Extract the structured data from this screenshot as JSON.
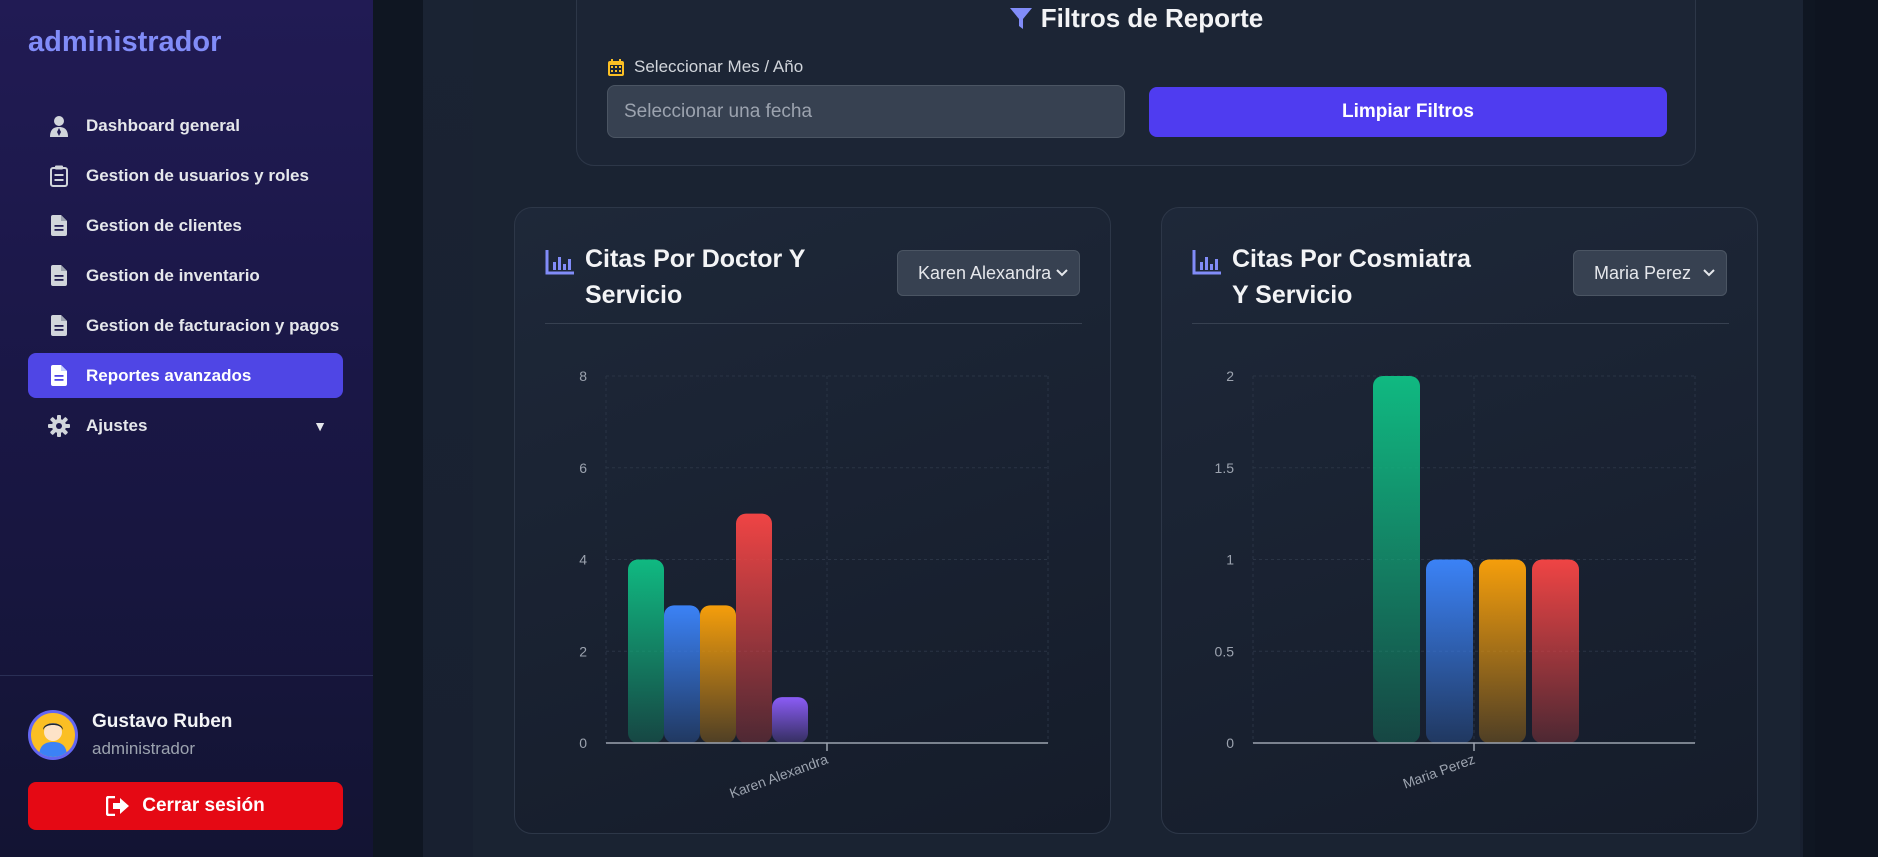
{
  "sidebar": {
    "brand": "administrador",
    "items": [
      {
        "label": "Dashboard general",
        "icon": "user-tie-icon"
      },
      {
        "label": "Gestion de usuarios y roles",
        "icon": "clipboard-list-icon"
      },
      {
        "label": "Gestion de clientes",
        "icon": "file-icon"
      },
      {
        "label": "Gestion de inventario",
        "icon": "file-icon"
      },
      {
        "label": "Gestion de facturacion y pagos",
        "icon": "file-icon"
      },
      {
        "label": "Reportes avanzados",
        "icon": "file-icon",
        "active": true
      },
      {
        "label": "Ajustes",
        "icon": "gear-icon",
        "caret": "▼"
      }
    ],
    "user": {
      "name": "Gustavo Ruben",
      "role": "administrador"
    },
    "logout_label": "Cerrar sesión"
  },
  "filters": {
    "title": "Filtros de Reporte",
    "date_label": "Seleccionar Mes / Año",
    "date_placeholder": "Seleccionar una fecha",
    "clear_label": "Limpiar Filtros"
  },
  "colors": {
    "accent": "#4f46e5",
    "logout": "#e50914",
    "bar_green": "#10b981",
    "bar_blue": "#3b82f6",
    "bar_orange": "#f59e0b",
    "bar_red": "#ef4444",
    "bar_purple": "#8b5cf6"
  },
  "cards": [
    {
      "title": "Citas Por Doctor Y Servicio",
      "selected": "Karen Alexandra"
    },
    {
      "title": "Citas Por Cosmiatra Y Servicio",
      "selected": "Maria Perez"
    }
  ],
  "chart_data": [
    {
      "type": "bar",
      "categories": [
        "Karen Alexandra"
      ],
      "series": [
        {
          "values": [
            4
          ],
          "color": "#10b981"
        },
        {
          "values": [
            3
          ],
          "color": "#3b82f6"
        },
        {
          "values": [
            3
          ],
          "color": "#f59e0b"
        },
        {
          "values": [
            5
          ],
          "color": "#ef4444"
        },
        {
          "values": [
            1
          ],
          "color": "#8b5cf6"
        }
      ],
      "yticks": [
        "0",
        "2",
        "4",
        "6",
        "8"
      ],
      "ylim": [
        0,
        8
      ],
      "grid": true
    },
    {
      "type": "bar",
      "categories": [
        "Maria Perez"
      ],
      "series": [
        {
          "values": [
            2
          ],
          "color": "#10b981"
        },
        {
          "values": [
            1
          ],
          "color": "#3b82f6"
        },
        {
          "values": [
            1
          ],
          "color": "#f59e0b"
        },
        {
          "values": [
            1
          ],
          "color": "#ef4444"
        }
      ],
      "yticks": [
        "0",
        "0.5",
        "1",
        "1.5",
        "2"
      ],
      "ylim": [
        0,
        2
      ],
      "grid": true
    }
  ]
}
